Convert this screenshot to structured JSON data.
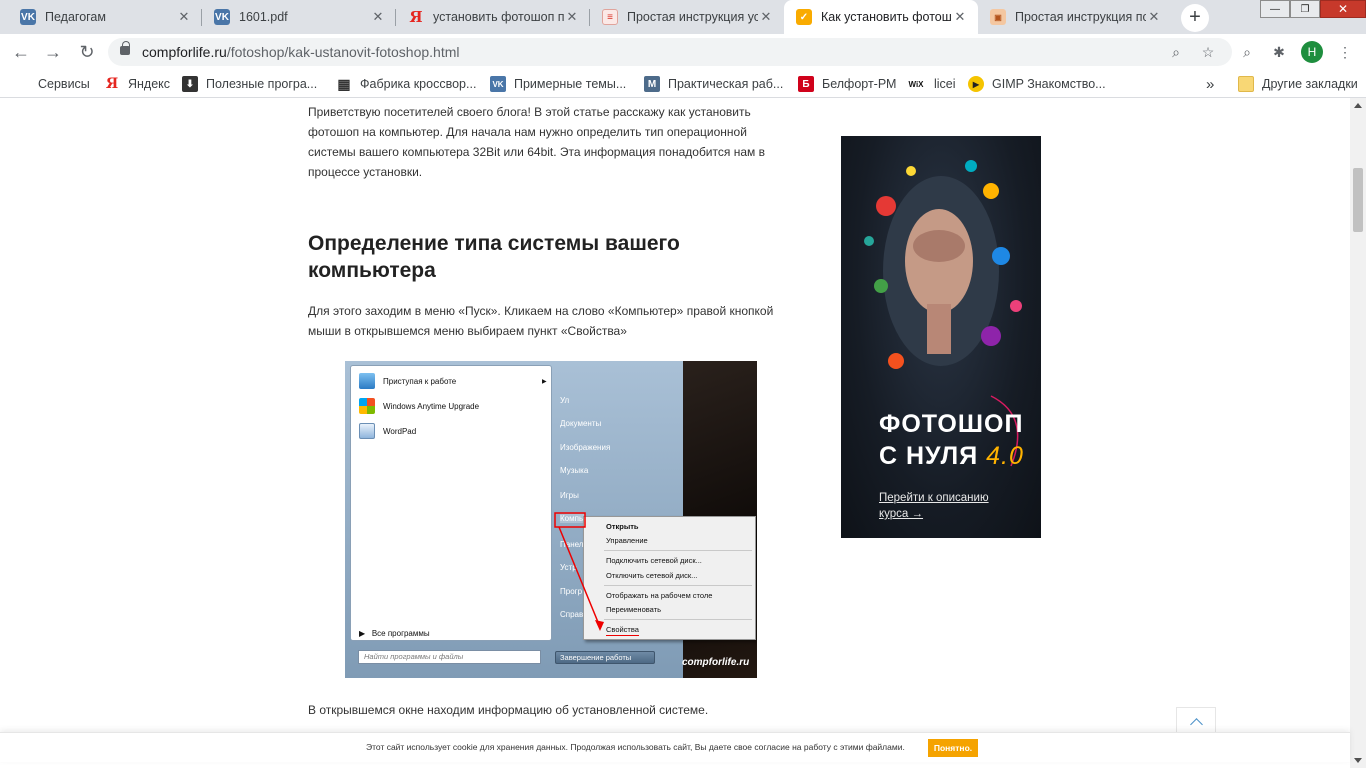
{
  "tabs": [
    {
      "title": "Педагогам",
      "favicon": "vk-icon",
      "fav_text": "VK"
    },
    {
      "title": "1601.pdf",
      "favicon": "vk-icon",
      "fav_text": "VK"
    },
    {
      "title": "установить фотошоп по",
      "favicon": "yandex-icon",
      "fav_text": "Я"
    },
    {
      "title": "Простая инструкция ус",
      "favicon": "document-icon",
      "fav_text": "≡"
    },
    {
      "title": "Как установить фотош",
      "favicon": "checkmark-icon",
      "fav_text": "✓",
      "active": true
    },
    {
      "title": "Простая инструкция по",
      "favicon": "image-icon",
      "fav_text": "▣"
    }
  ],
  "tab_close_glyph": "✕",
  "new_tab_glyph": "+",
  "window_controls": {
    "minimize": "—",
    "maximize": "❐",
    "close": "✕"
  },
  "toolbar": {
    "back": "←",
    "forward": "→",
    "reload": "↻",
    "url_host": "compforlife.ru",
    "url_path": "/fotoshop/kak-ustanovit-fotoshop.html",
    "zoom_icon": "⌕",
    "star_icon": "☆",
    "search_ext": "⌕",
    "puzzle_icon": "✱",
    "avatar_letter": "Н",
    "menu_icon": "⋮"
  },
  "bookmarks": [
    {
      "label": "Сервисы",
      "icon": "apps-grid-icon"
    },
    {
      "label": "Яндекс",
      "icon": "yandex-icon",
      "glyph": "Я"
    },
    {
      "label": "Полезные програ...",
      "icon": "download-icon",
      "glyph": "⬇"
    },
    {
      "label": "Фабрика кроссвор...",
      "icon": "crossword-icon",
      "glyph": "▦"
    },
    {
      "label": "Примерные темы...",
      "icon": "vk-icon",
      "glyph": "VK"
    },
    {
      "label": "Практическая раб...",
      "icon": "m-icon",
      "glyph": "M"
    },
    {
      "label": "Белфорт-РМ",
      "icon": "b-icon",
      "glyph": "Б"
    },
    {
      "label": "licei",
      "icon": "wix-icon",
      "glyph": "WiX"
    },
    {
      "label": "GIMP Знакомство...",
      "icon": "play-icon",
      "glyph": "▶"
    }
  ],
  "bookmarks_more": "»",
  "other_bookmarks": "Другие закладки",
  "article": {
    "intro": "Приветствую посетителей своего блога! В этой статье расскажу как установить фотошоп на компьютер. Для начала нам нужно определить тип операционной системы вашего компьютера 32Bit или 64bit.  Эта информация понадобится нам в процессе установки.",
    "heading": "Определение типа системы вашего компьютера",
    "step": "Для этого заходим в меню «Пуск». Кликаем на слово «Компьютер» правой кнопкой мыши в открывшемся меню выбираем пункт «Свойства»",
    "after": "В открывшемся окне находим информацию об установленной системе."
  },
  "screenshot": {
    "left_items": [
      "Приступая к работе",
      "Windows Anytime Upgrade",
      "WordPad"
    ],
    "all_programs": "Все программы",
    "search_placeholder": "Найти программы и файлы",
    "right_items": [
      "Ул",
      "Документы",
      "Изображения",
      "Музыка",
      "Игры",
      "Компь",
      "Панел",
      "Устр",
      "Прогр",
      "Справ"
    ],
    "shutdown": "Завершение работы",
    "context_menu": [
      "Открыть",
      "Управление",
      "Подключить сетевой диск...",
      "Отключить сетевой диск...",
      "Отображать на рабочем столе",
      "Переименовать",
      "Свойства"
    ],
    "watermark": "compforlife.ru"
  },
  "ad": {
    "title_line1": "ФОТОШОП",
    "title_line2": "С НУЛЯ",
    "version": "4.0",
    "link": "Перейти к описанию курса →"
  },
  "cookie": {
    "text": "Этот сайт использует cookie для хранения данных. Продолжая использовать сайт, Вы даете свое согласие на работу с этими файлами.",
    "button": "Понятно."
  }
}
